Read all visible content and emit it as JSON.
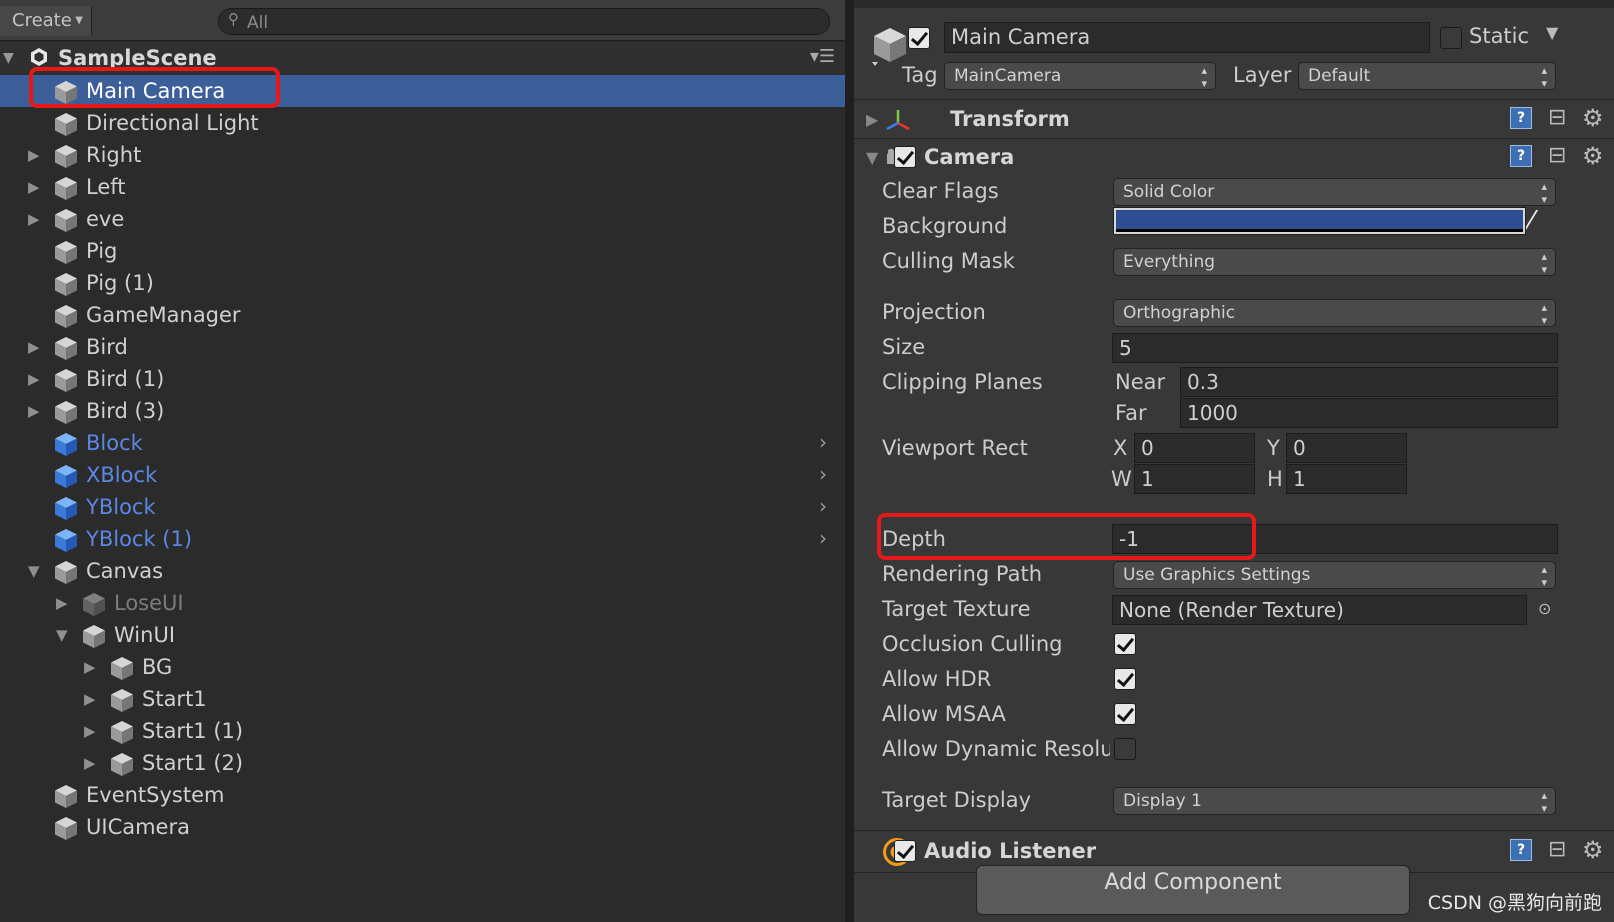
{
  "hierarchy": {
    "create_label": "Create",
    "search_placeholder": "All",
    "scene_name": "SampleScene",
    "items": [
      {
        "label": "Main Camera",
        "selected": true,
        "state": "normal"
      },
      {
        "label": "Directional Light",
        "state": "normal"
      },
      {
        "label": "Right",
        "state": "normal",
        "expand": "collapsed"
      },
      {
        "label": "Left",
        "state": "normal",
        "expand": "collapsed"
      },
      {
        "label": "eve",
        "state": "normal",
        "expand": "collapsed"
      },
      {
        "label": "Pig",
        "state": "normal"
      },
      {
        "label": "Pig (1)",
        "state": "normal"
      },
      {
        "label": "GameManager",
        "state": "normal"
      },
      {
        "label": "Bird",
        "state": "normal",
        "expand": "collapsed"
      },
      {
        "label": "Bird (1)",
        "state": "normal",
        "expand": "collapsed"
      },
      {
        "label": "Bird (3)",
        "state": "normal",
        "expand": "collapsed"
      },
      {
        "label": "Block",
        "state": "prefab"
      },
      {
        "label": "XBlock",
        "state": "prefab"
      },
      {
        "label": "YBlock",
        "state": "prefab"
      },
      {
        "label": "YBlock (1)",
        "state": "prefab"
      },
      {
        "label": "Canvas",
        "state": "normal",
        "expand": "expanded"
      },
      {
        "label": "LoseUI",
        "state": "disabled",
        "expand": "collapsed"
      },
      {
        "label": "WinUI",
        "state": "normal",
        "expand": "expanded"
      },
      {
        "label": "BG",
        "state": "normal",
        "expand": "collapsed"
      },
      {
        "label": "Start1",
        "state": "normal",
        "expand": "collapsed"
      },
      {
        "label": "Start1 (1)",
        "state": "normal",
        "expand": "collapsed"
      },
      {
        "label": "Start1 (2)",
        "state": "normal",
        "expand": "collapsed"
      },
      {
        "label": "EventSystem",
        "state": "normal"
      },
      {
        "label": "UICamera",
        "state": "normal"
      }
    ]
  },
  "inspector": {
    "object_name": "Main Camera",
    "active": true,
    "static_label": "Static",
    "static_checked": false,
    "tag_label": "Tag",
    "tag_value": "MainCamera",
    "layer_label": "Layer",
    "layer_value": "Default",
    "transform_title": "Transform",
    "camera_title": "Camera",
    "camera_enabled": true,
    "clear_flags": {
      "label": "Clear Flags",
      "value": "Solid Color"
    },
    "background": {
      "label": "Background",
      "color": "#2d4f92"
    },
    "culling_mask": {
      "label": "Culling Mask",
      "value": "Everything"
    },
    "projection": {
      "label": "Projection",
      "value": "Orthographic"
    },
    "size": {
      "label": "Size",
      "value": "5"
    },
    "clipping_planes": {
      "label": "Clipping Planes",
      "near_label": "Near",
      "near": "0.3",
      "far_label": "Far",
      "far": "1000"
    },
    "viewport_rect": {
      "label": "Viewport Rect",
      "x_label": "X",
      "x": "0",
      "y_label": "Y",
      "y": "0",
      "w_label": "W",
      "w": "1",
      "h_label": "H",
      "h": "1"
    },
    "depth": {
      "label": "Depth",
      "value": "-1"
    },
    "rendering_path": {
      "label": "Rendering Path",
      "value": "Use Graphics Settings"
    },
    "target_texture": {
      "label": "Target Texture",
      "value": "None (Render Texture)"
    },
    "occlusion_culling": {
      "label": "Occlusion Culling",
      "checked": true
    },
    "allow_hdr": {
      "label": "Allow HDR",
      "checked": true
    },
    "allow_msaa": {
      "label": "Allow MSAA",
      "checked": true
    },
    "allow_dynamic_resolution": {
      "label": "Allow Dynamic Resolutic",
      "checked": false
    },
    "target_display": {
      "label": "Target Display",
      "value": "Display 1"
    },
    "audio_listener_title": "Audio Listener",
    "audio_listener_enabled": true,
    "add_component_label": "Add Component"
  },
  "watermark": "CSDN @黑狗向前跑",
  "colors": {
    "selection": "#3d5f99",
    "prefab_text": "#5b88e4",
    "annotation": "#e61818"
  }
}
